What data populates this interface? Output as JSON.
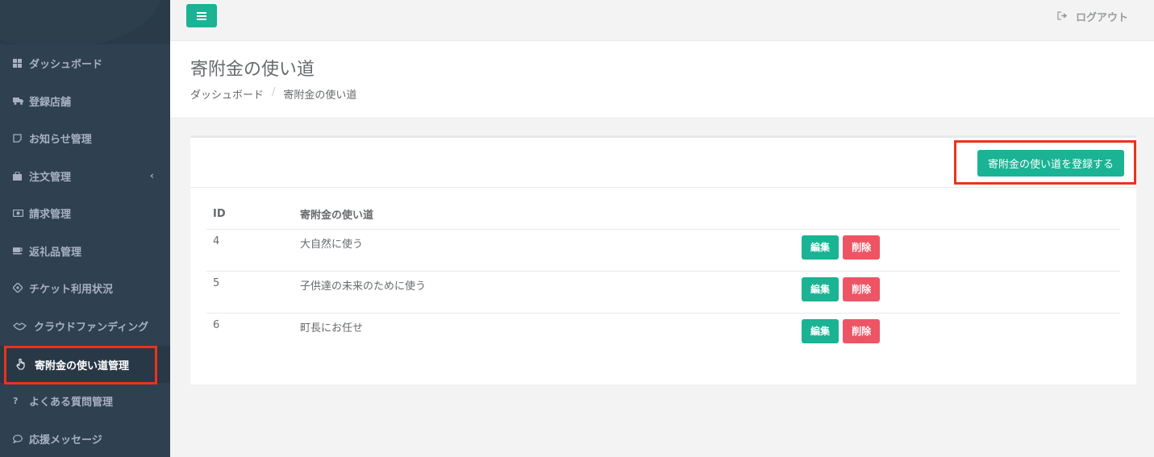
{
  "topbar": {
    "menu_icon": "hamburger-icon",
    "logout_label": "ログアウト",
    "logout_icon": "sign-out-icon"
  },
  "sidebar": {
    "items": [
      {
        "label": "ダッシュボード",
        "icon": "th-large-icon"
      },
      {
        "label": "登録店舗",
        "icon": "truck-icon"
      },
      {
        "label": "お知らせ管理",
        "icon": "sticky-note-icon"
      },
      {
        "label": "注文管理",
        "icon": "shopping-bag-icon"
      },
      {
        "label": "請求管理",
        "icon": "money-icon"
      },
      {
        "label": "返礼品管理",
        "icon": "coffee-icon"
      },
      {
        "label": "チケット利用状況",
        "icon": "ticket-icon"
      },
      {
        "label": "クラウドファンディング",
        "icon": "handshake-icon"
      },
      {
        "label": "寄附金の使い道管理",
        "icon": "hand-pointer-icon"
      },
      {
        "label": "よくある質問管理",
        "icon": "question-icon"
      },
      {
        "label": "応援メッセージ",
        "icon": "comment-icon"
      }
    ],
    "active_index": 8
  },
  "page": {
    "title": "寄附金の使い道",
    "breadcrumb": [
      "ダッシュボード",
      "寄附金の使い道"
    ],
    "breadcrumb_sep": "/"
  },
  "panel": {
    "register_label": "寄附金の使い道を登録する"
  },
  "table": {
    "headers": [
      "ID",
      "寄附金の使い道"
    ],
    "rows": [
      {
        "id": "4",
        "use": "大自然に使う"
      },
      {
        "id": "5",
        "use": "子供達の未来のために使う"
      },
      {
        "id": "6",
        "use": "町長にお任せ"
      }
    ],
    "edit_label": "編集",
    "delete_label": "削除"
  },
  "colors": {
    "primary": "#1ab394",
    "danger": "#ed5565",
    "sidebar": "#2f4050",
    "highlight": "#e8341c"
  }
}
